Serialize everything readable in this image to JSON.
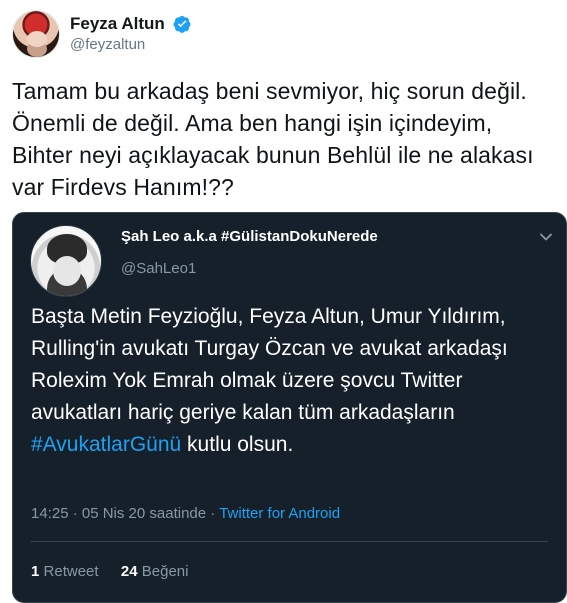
{
  "main_tweet": {
    "author": {
      "display_name": "Feyza Altun",
      "handle": "@feyzaltun",
      "verified_icon": "verified-badge-icon",
      "avatar_icon": "avatar"
    },
    "text": "Tamam bu arkadaş beni sevmiyor, hiç sorun değil. Önemli de değil. Ama ben hangi işin içindeyim, Bihter neyi açıklayacak bunun Behlül ile ne alakası var Firdevs Hanım!??"
  },
  "quoted_tweet": {
    "author": {
      "display_name": "Şah Leo a.k.a #GülistanDokuNerede",
      "handle": "@SahLeo1",
      "avatar_icon": "avatar"
    },
    "text_parts": {
      "before_hashtag": "Başta Metin Feyzioğlu, Feyza Altun, Umur Yıldırım, Rulling'in avukatı Turgay Özcan ve avukat arkadaşı Rolexim Yok Emrah olmak üzere şovcu Twitter avukatları hariç geriye kalan tüm arkadaşların ",
      "hashtag": "#AvukatlarGünü",
      "after_hashtag": " kutlu olsun."
    },
    "meta": {
      "time_date": "14:25 · 05 Nis 20 saatinde · ",
      "source": "Twitter for Android"
    },
    "stats": {
      "retweets_count": "1",
      "retweets_label": "Retweet",
      "likes_count": "24",
      "likes_label": "Beğeni"
    },
    "menu_icon": "chevron-down-icon"
  },
  "colors": {
    "link_blue": "#1da1f2",
    "dark_bg": "#15202b",
    "muted_gray": "#8899a6"
  }
}
